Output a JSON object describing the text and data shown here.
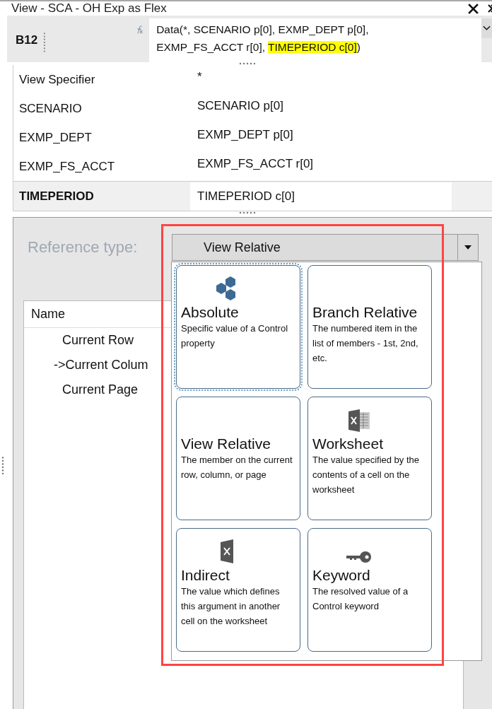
{
  "window": {
    "title": "View - SCA - OH Exp as Flex"
  },
  "formula_bar": {
    "cell": "B12",
    "segments": [
      {
        "text": "Data(*, SCENARIO p[0], EXMP_DEPT p[0], EXMP_FS_ACCT r[0], ",
        "highlighted": false
      },
      {
        "text": "TIMEPERIOD c[0]",
        "highlighted": true
      },
      {
        "text": ")",
        "highlighted": false
      }
    ]
  },
  "properties": [
    {
      "name": "View Specifier",
      "value": "*",
      "selected": false
    },
    {
      "name": "SCENARIO",
      "value": "SCENARIO p[0]",
      "selected": false
    },
    {
      "name": "EXMP_DEPT",
      "value": "EXMP_DEPT p[0]",
      "selected": false
    },
    {
      "name": "EXMP_FS_ACCT",
      "value": "EXMP_FS_ACCT r[0]",
      "selected": false
    },
    {
      "name": "TIMEPERIOD",
      "value": "TIMEPERIOD c[0]",
      "selected": true
    }
  ],
  "reference_type": {
    "label": "Reference type:",
    "value": "View Relative"
  },
  "name_list": {
    "header": "Name",
    "items": [
      "Current Row",
      "->Current Colum",
      "Current Page"
    ]
  },
  "reference_options": [
    {
      "title": "Absolute",
      "description": "Specific value of a Control property",
      "focused": true
    },
    {
      "title": "Branch Relative",
      "description": "The numbered item in the list of members - 1st, 2nd, etc.",
      "focused": false
    },
    {
      "title": "View Relative",
      "description": "The member on the current row, column, or page",
      "focused": false
    },
    {
      "title": "Worksheet",
      "description": "The value specified by the contents of a cell on the worksheet",
      "focused": false
    },
    {
      "title": "Indirect",
      "description": "The value which defines this argument in another cell on the worksheet",
      "focused": false
    },
    {
      "title": "Keyword",
      "description": "The resolved value of a Control keyword",
      "focused": false
    }
  ]
}
